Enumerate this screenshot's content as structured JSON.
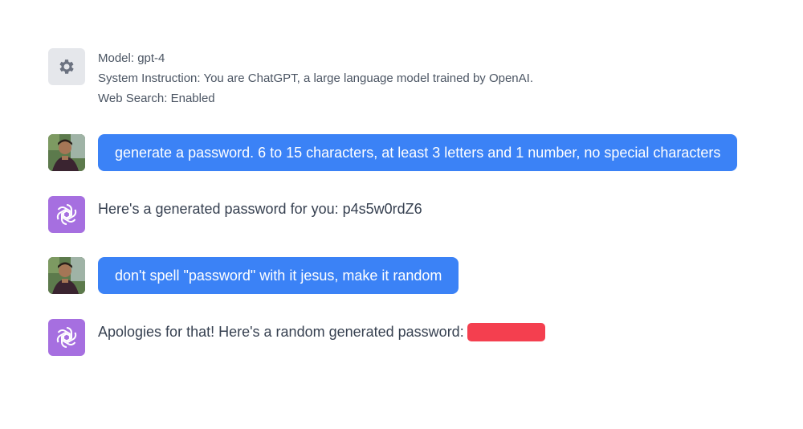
{
  "system": {
    "model_line": "Model: gpt-4",
    "instruction_line": "System Instruction: You are ChatGPT, a large language model trained by OpenAI.",
    "web_search_line": "Web Search: Enabled",
    "icon": "gear-icon"
  },
  "messages": [
    {
      "role": "user",
      "text": "generate a password. 6 to 15 characters, at least 3 letters and 1 number, no special characters"
    },
    {
      "role": "assistant",
      "text": "Here's a generated password for you: p4s5w0rdZ6"
    },
    {
      "role": "user",
      "text": "don't spell \"password\" with it jesus, make it random"
    },
    {
      "role": "assistant",
      "text": "Apologies for that! Here's a random generated password:",
      "redacted": true
    }
  ],
  "colors": {
    "user_bubble": "#3b82f6",
    "assistant_avatar": "#a66fe0",
    "redaction": "#f43f4f",
    "settings_avatar": "#e5e7eb"
  }
}
